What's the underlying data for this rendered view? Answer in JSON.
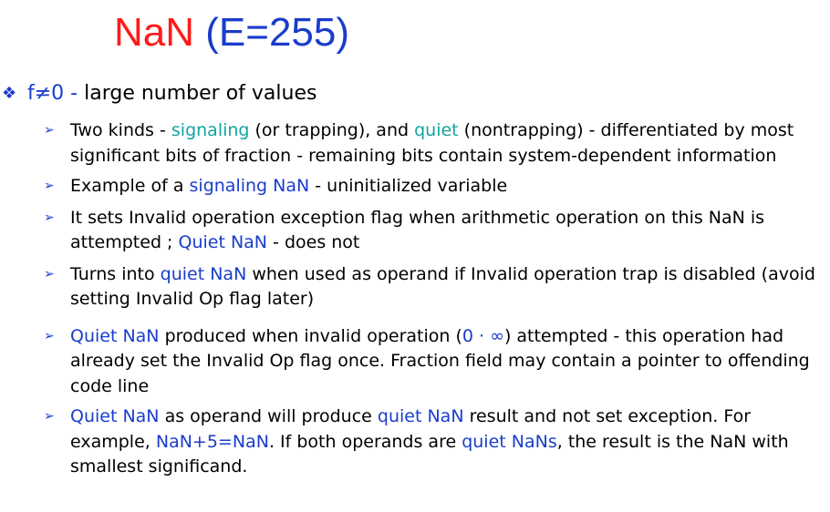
{
  "title": {
    "main": "NaN",
    "sub": "(E=255)"
  },
  "level1": {
    "bullet_icon": "diamond-bullet-icon",
    "condition": "f≠0 -",
    "text": "large number of values"
  },
  "items": [
    {
      "p1": "Two kinds - ",
      "k1": "signaling",
      "p2": " (or trapping), and ",
      "k2": "quiet",
      "p3": " (nontrapping) - differentiated by most significant bits of fraction -  remaining bits contain system-dependent information"
    },
    {
      "p1": "Example of a ",
      "k1": "signaling NaN",
      "p2": " - uninitialized variable"
    },
    {
      "p1": "It sets Invalid operation exception flag when arithmetic operation on this NaN is attempted ; ",
      "k1": "Quiet NaN",
      "p2": " - does not"
    },
    {
      "p1": "Turns into ",
      "k1": "quiet NaN",
      "p2": " when used as operand if Invalid operation trap is disabled (avoid setting Invalid Op flag later)"
    },
    {
      "k1": "Quiet NaN",
      "p1": " produced when invalid operation (",
      "k2": "0 · ∞",
      "p2": ") attempted - this operation had already set the Invalid Op flag once. Fraction field may contain a pointer to offending code line"
    },
    {
      "k1": "Quiet NaN",
      "p1": " as operand will produce ",
      "k2": "quiet NaN",
      "p2": " result and not set exception. For example, ",
      "k3": "NaN+5=NaN",
      "p3": ". If both operands are ",
      "k4": "quiet NaNs",
      "p4": ", the result is the NaN with smallest significand."
    }
  ],
  "arrow_icon": "arrow-bullet-icon",
  "colors": {
    "title_red": "#ff1a1a",
    "accent_blue": "#1a3ccc",
    "accent_teal": "#12a3a3"
  }
}
